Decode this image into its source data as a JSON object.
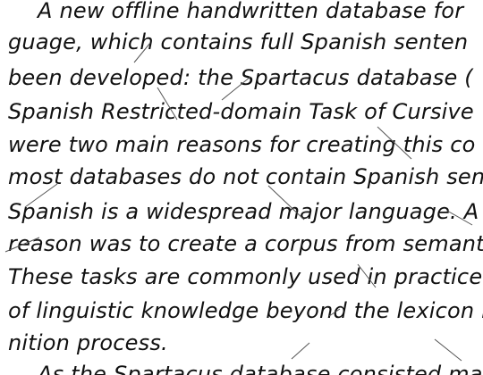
{
  "document": {
    "lines": [
      "A new offline handwritten database for",
      "guage, which contains full Spanish senten",
      "been developed: the Spartacus database (",
      "Spanish Restricted-domain Task of Cursive",
      "were two main reasons for creating this co",
      "most databases do not contain Spanish sente",
      "Spanish is a widespread major language. A",
      "reason was to create a corpus from semanti",
      "These tasks are commonly used in practice",
      "of linguistic knowledge beyond the lexicon i",
      "nition process.",
      "As the Spartacus database consisted ma"
    ]
  }
}
